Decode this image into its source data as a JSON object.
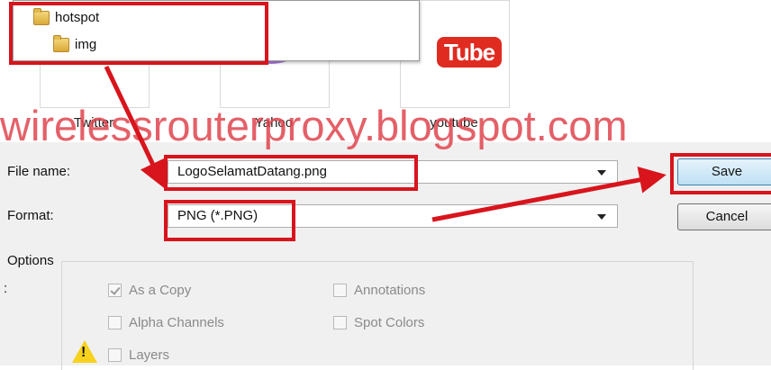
{
  "watermark": "wirelessrouterproxy.blogspot.com",
  "folders": [
    {
      "label": "hotspot"
    },
    {
      "label": "img"
    }
  ],
  "files": [
    {
      "label": "Twitter",
      "icon": "twitter-icon"
    },
    {
      "label": "Yahoo",
      "icon": "yahoo-icon"
    },
    {
      "label": "youtube",
      "icon": "youtube-icon",
      "logo_text": "Tube"
    }
  ],
  "form": {
    "file_name_label": "File name:",
    "file_name_value": "LogoSelamatDatang.png",
    "format_label": "Format:",
    "format_value": "PNG (*.PNG)",
    "save_label": "Save",
    "cancel_label": "Cancel",
    "options_label": "Options",
    "options_prefix": ":"
  },
  "options": {
    "as_copy": {
      "label": "As a Copy",
      "checked": true
    },
    "alpha_channels": {
      "label": "Alpha Channels",
      "checked": false
    },
    "layers": {
      "label": "Layers",
      "checked": false
    },
    "annotations": {
      "label": "Annotations",
      "checked": false
    },
    "spot_colors": {
      "label": "Spot Colors",
      "checked": false
    }
  },
  "colors": {
    "annotation_red": "#d8141c",
    "watermark": "#e0454e",
    "save_button": "#bfe0f4"
  }
}
